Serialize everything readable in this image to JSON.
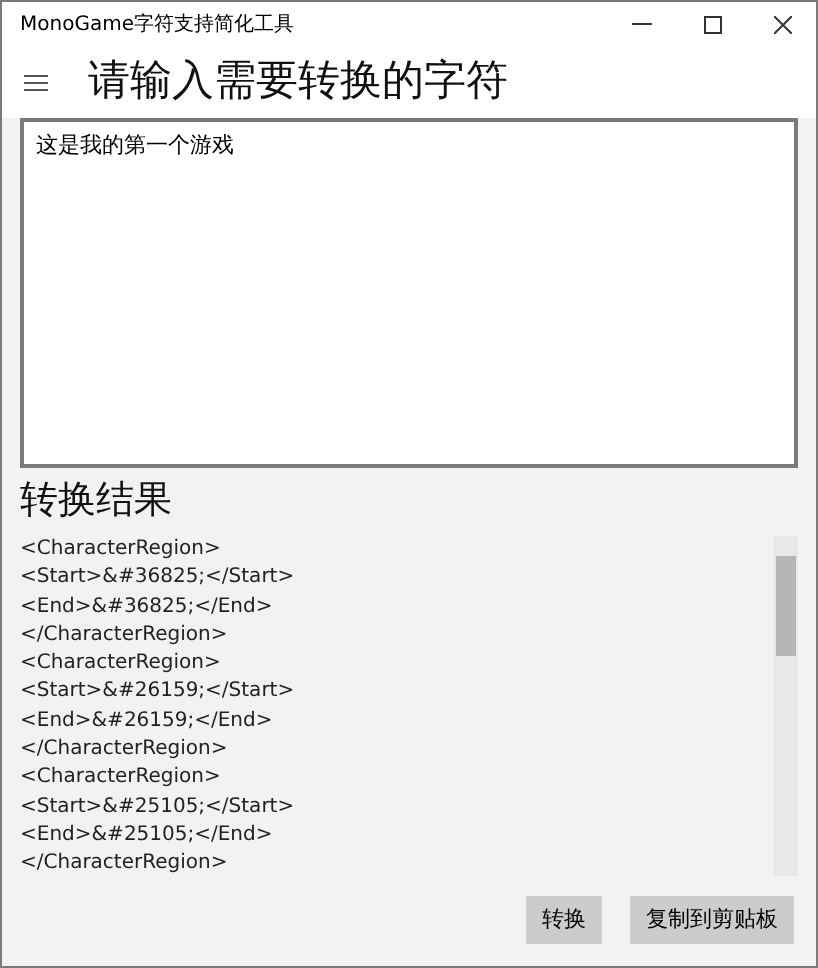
{
  "window": {
    "title": "MonoGame字符支持简化工具"
  },
  "header": {
    "title": "请输入需要转换的字符"
  },
  "input": {
    "value": "这是我的第一个游戏"
  },
  "result": {
    "title": "转换结果",
    "lines": [
      "<CharacterRegion>",
      "<Start>&#36825;</Start>",
      "<End>&#36825;</End>",
      "</CharacterRegion>",
      "<CharacterRegion>",
      "<Start>&#26159;</Start>",
      "<End>&#26159;</End>",
      "</CharacterRegion>",
      "<CharacterRegion>",
      "<Start>&#25105;</Start>",
      "<End>&#25105;</End>",
      "</CharacterRegion>"
    ]
  },
  "buttons": [
    "转换",
    "复制到剪贴板"
  ]
}
